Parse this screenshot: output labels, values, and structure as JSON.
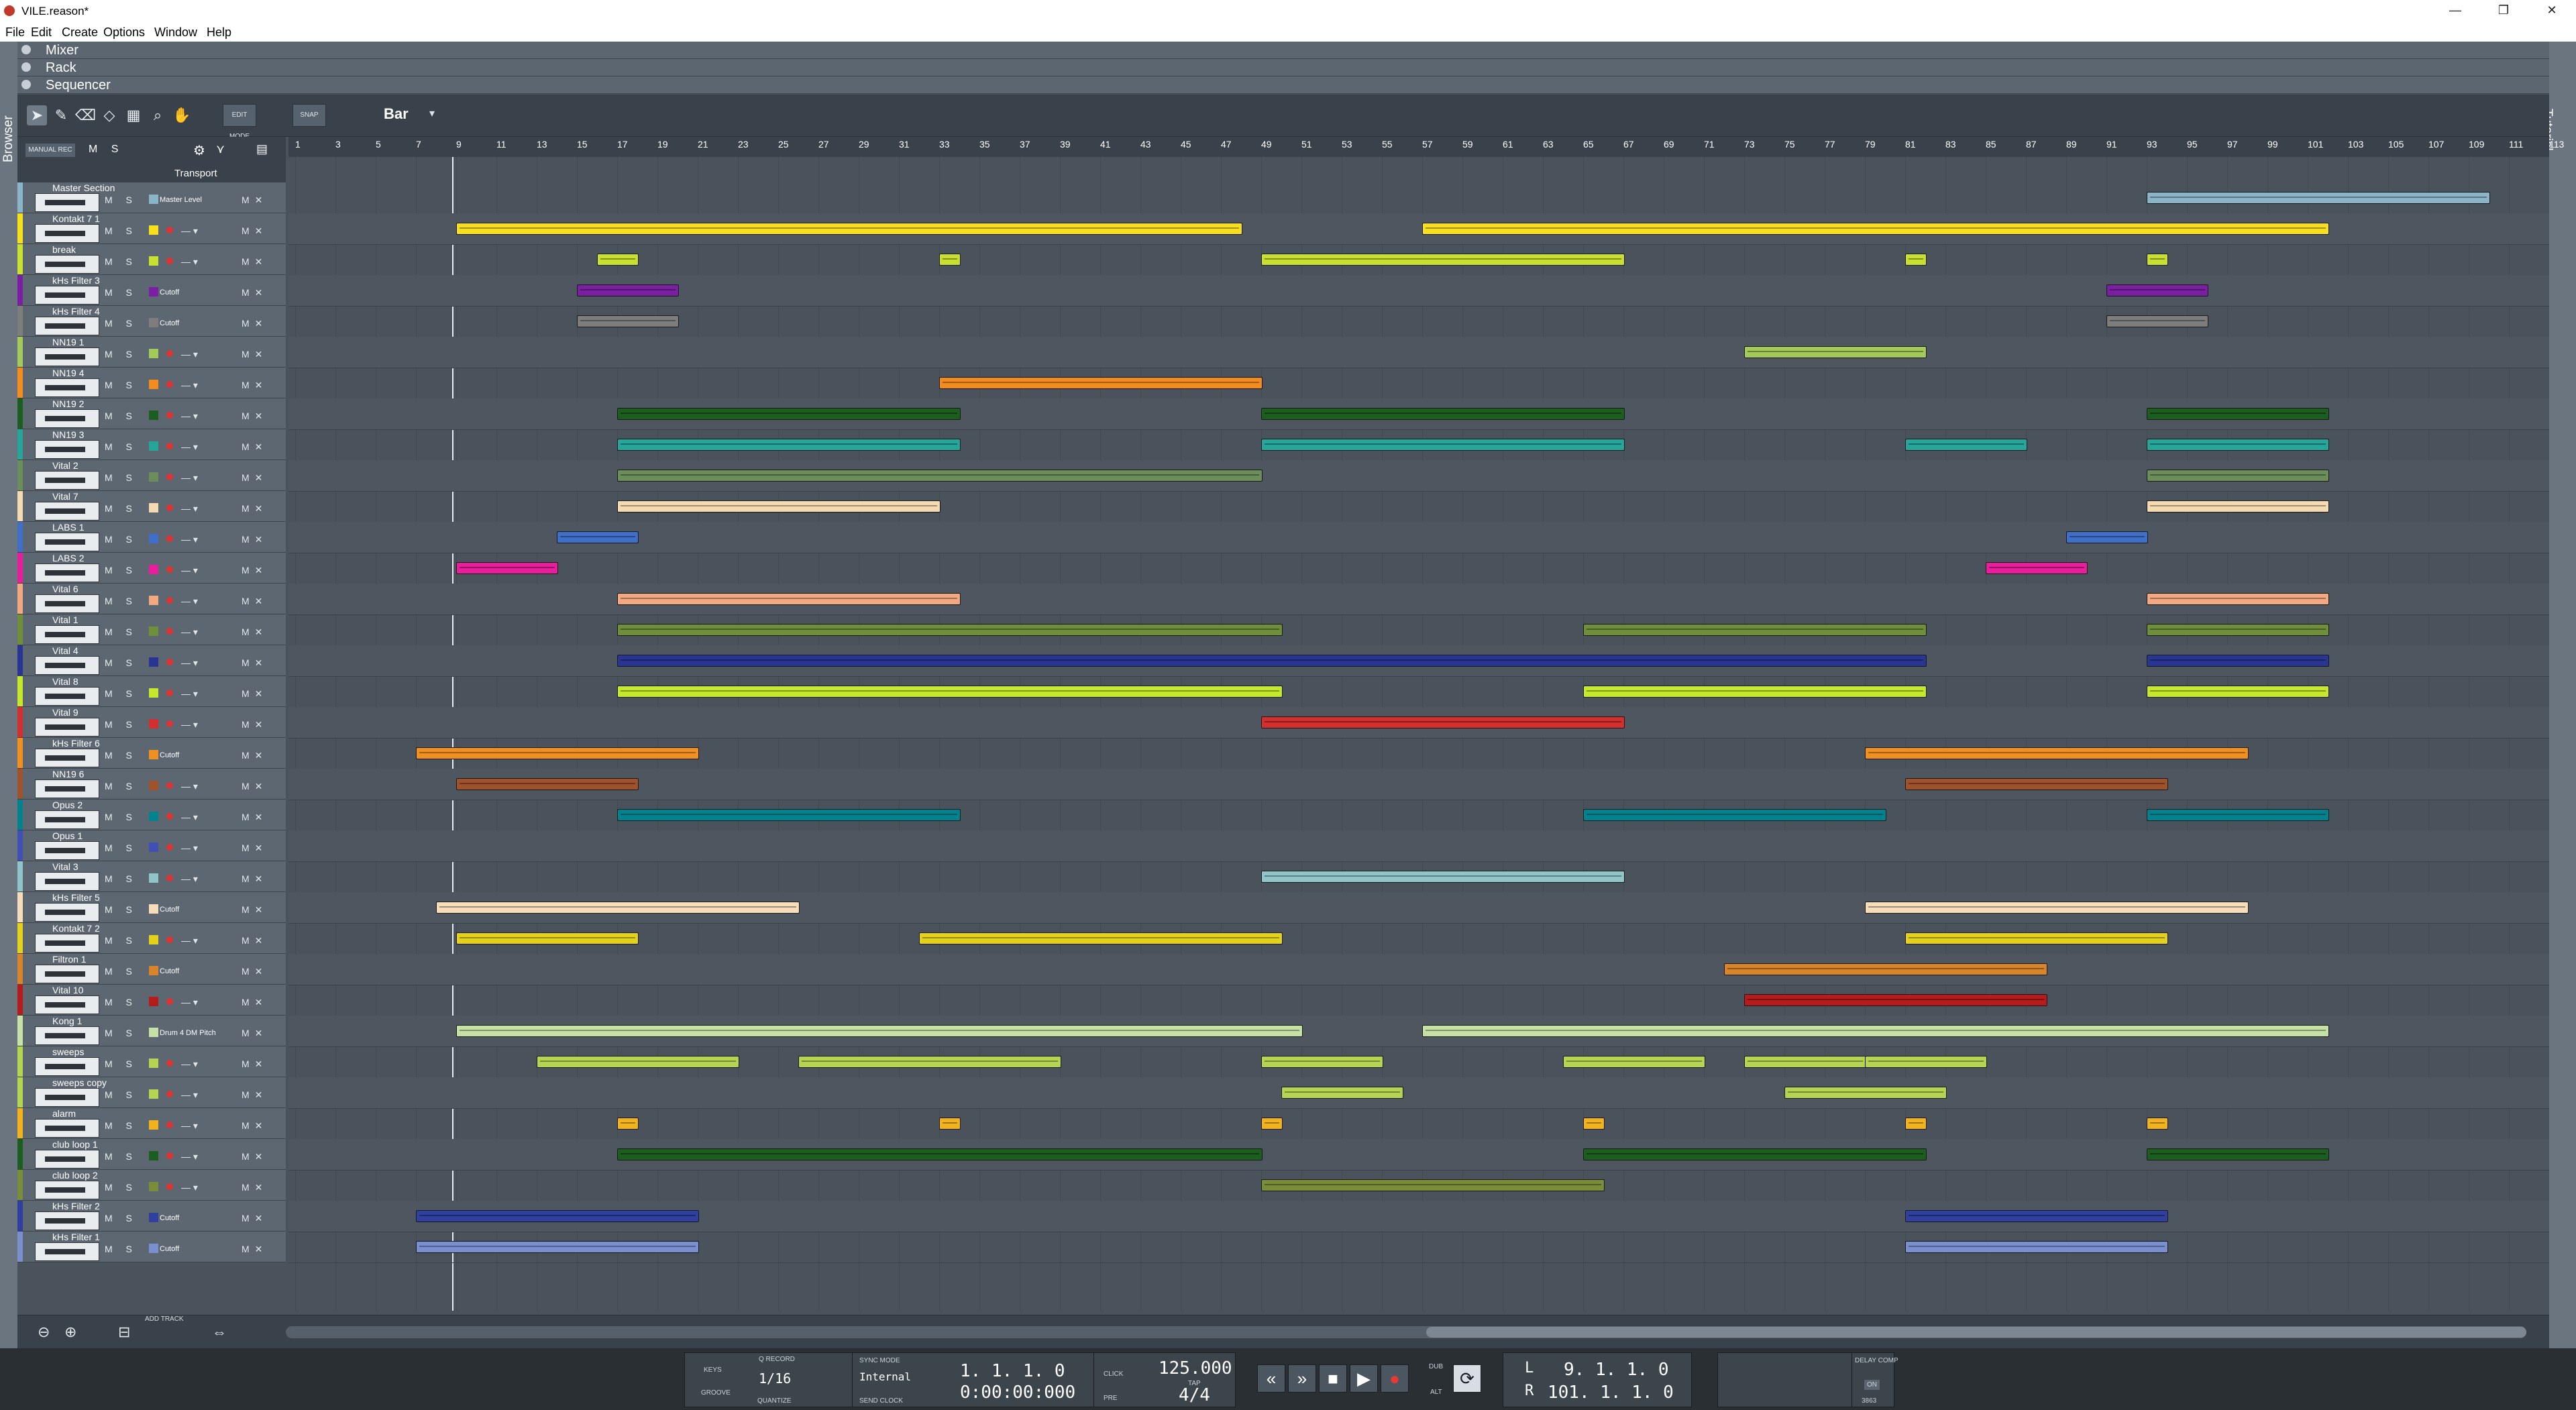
{
  "window": {
    "title": "VILE.reason*",
    "controls": {
      "minimize": "—",
      "restore": "❐",
      "close": "✕"
    }
  },
  "menubar": [
    "File",
    "Edit",
    "Create",
    "Options",
    "Window",
    "Help"
  ],
  "side": {
    "browser": "Browser",
    "tutorial": "Tutorial"
  },
  "sections": {
    "mixer": "Mixer",
    "rack": "Rack",
    "sequencer": "Sequencer"
  },
  "toolbar": {
    "edit_mode": "EDIT MODE",
    "snap": "SNAP",
    "snap_value": "Bar",
    "manual_rec": "MANUAL REC",
    "transport_label": "Transport",
    "ms": "M S",
    "tools": [
      "select-tool",
      "pencil-tool",
      "eraser-tool",
      "razor-tool",
      "mute-tool",
      "magnify-tool",
      "hand-tool"
    ]
  },
  "ruler": [
    "1",
    "3",
    "5",
    "7",
    "9",
    "11",
    "13",
    "15",
    "17",
    "19",
    "21",
    "23",
    "25",
    "27",
    "29",
    "31",
    "33",
    "35",
    "37",
    "39",
    "41",
    "43",
    "45",
    "47",
    "49",
    "51",
    "53",
    "55",
    "57",
    "59",
    "61",
    "63",
    "65",
    "67",
    "69",
    "71",
    "73",
    "75",
    "77",
    "79",
    "81",
    "83",
    "85",
    "87",
    "89",
    "91",
    "93",
    "95",
    "97",
    "99",
    "101",
    "103",
    "105",
    "107",
    "109",
    "111",
    "113"
  ],
  "tracks": [
    {
      "name": "Master Section",
      "param": "Master Level",
      "color": "#8ab4c7"
    },
    {
      "name": "Kontakt 7 1",
      "param": "",
      "color": "#f7e01b"
    },
    {
      "name": "break",
      "param": "",
      "color": "#c8e030"
    },
    {
      "name": "kHs Filter 3",
      "param": "Cutoff",
      "color": "#7b1fa2"
    },
    {
      "name": "kHs Filter 4",
      "param": "Cutoff",
      "color": "#7d7d7d"
    },
    {
      "name": "NN19 1",
      "param": "",
      "color": "#a3c95a"
    },
    {
      "name": "NN19 4",
      "param": "",
      "color": "#f28c1c"
    },
    {
      "name": "NN19 2",
      "param": "",
      "color": "#1b5e20"
    },
    {
      "name": "NN19 3",
      "param": "",
      "color": "#26a69a"
    },
    {
      "name": "Vital 2",
      "param": "",
      "color": "#6b8e5a"
    },
    {
      "name": "Vital 7",
      "param": "",
      "color": "#f5d9b0"
    },
    {
      "name": "LABS 1",
      "param": "",
      "color": "#3f6fc8"
    },
    {
      "name": "LABS 2",
      "param": "",
      "color": "#e91e9c"
    },
    {
      "name": "Vital 6",
      "param": "",
      "color": "#f4a882"
    },
    {
      "name": "Vital 1",
      "param": "",
      "color": "#6f8f3a"
    },
    {
      "name": "Vital 4",
      "param": "",
      "color": "#283593"
    },
    {
      "name": "Vital 8",
      "param": "",
      "color": "#c6e82a"
    },
    {
      "name": "Vital 9",
      "param": "",
      "color": "#d32f2f"
    },
    {
      "name": "kHs Filter 6",
      "param": "Cutoff",
      "color": "#f09020"
    },
    {
      "name": "NN19 6",
      "param": "",
      "color": "#a0522d"
    },
    {
      "name": "Opus 2",
      "param": "",
      "color": "#00838f"
    },
    {
      "name": "Opus 1",
      "param": "",
      "color": "#3f51b5"
    },
    {
      "name": "Vital 3",
      "param": "",
      "color": "#8fc5c8"
    },
    {
      "name": "kHs Filter 5",
      "param": "Cutoff",
      "color": "#f6dcb8"
    },
    {
      "name": "Kontakt 7 2",
      "param": "",
      "color": "#e3d11a"
    },
    {
      "name": "Filtron 1",
      "param": "Cutoff",
      "color": "#d8842a"
    },
    {
      "name": "Vital 10",
      "param": "",
      "color": "#b71c1c"
    },
    {
      "name": "Kong 1",
      "param": "Drum 4 DM Pitch",
      "color": "#c5e1a5"
    },
    {
      "name": "sweeps",
      "param": "",
      "color": "#b4d452"
    },
    {
      "name": "sweeps copy",
      "param": "",
      "color": "#b4d452"
    },
    {
      "name": "alarm",
      "param": "",
      "color": "#f2b21c"
    },
    {
      "name": "club loop 1",
      "param": "",
      "color": "#1b5e20"
    },
    {
      "name": "club loop 2",
      "param": "",
      "color": "#7a8d3a"
    },
    {
      "name": "kHs Filter 2",
      "param": "Cutoff",
      "color": "#3040a0"
    },
    {
      "name": "kHs Filter 1",
      "param": "Cutoff",
      "color": "#7a8fd0"
    }
  ],
  "transport": {
    "keys": "KEYS",
    "groove": "GROOVE",
    "q_record": "Q RECORD",
    "quantize_value": "1/16",
    "quantize": "QUANTIZE",
    "sync_mode": "SYNC MODE",
    "sync_value": "Internal",
    "send_clock": "SEND CLOCK",
    "position_bars": "1. 1. 1.   0",
    "position_time": "0:00:00:000",
    "click": "CLICK",
    "pre": "PRE",
    "tempo": "125.000",
    "tap": "TAP",
    "signature": "4/4",
    "dub": "DUB",
    "alt": "ALT",
    "loop_left": "9. 1. 1.   0",
    "loop_right": "101. 1. 1.   0",
    "L": "L",
    "R": "R",
    "delay_comp": "DELAY COMP",
    "delay_on": "ON",
    "delay_value": "3863",
    "add_track": "ADD TRACK"
  }
}
